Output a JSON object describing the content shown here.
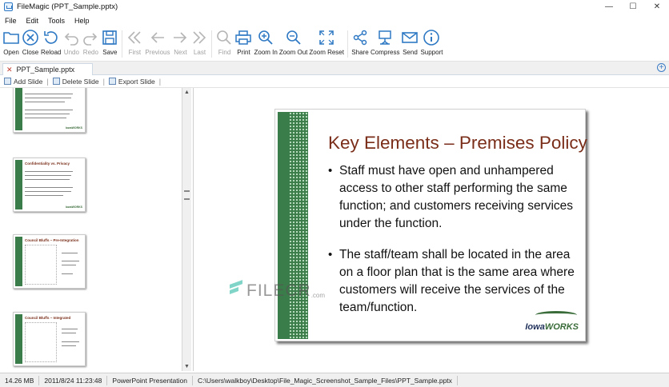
{
  "window": {
    "title": "FileMagic (PPT_Sample.pptx)",
    "controls": [
      "—",
      "☐",
      "✕"
    ]
  },
  "menu": [
    "File",
    "Edit",
    "Tools",
    "Help"
  ],
  "toolbar": {
    "open": "Open",
    "close": "Close",
    "reload": "Reload",
    "undo": "Undo",
    "redo": "Redo",
    "save": "Save",
    "first": "First",
    "previous": "Previous",
    "next": "Next",
    "last": "Last",
    "find": "Find",
    "print": "Print",
    "zoom_in": "Zoom In",
    "zoom_out": "Zoom Out",
    "zoom_reset": "Zoom Reset",
    "share": "Share",
    "compress": "Compress",
    "send": "Send",
    "support": "Support"
  },
  "tabs": {
    "doc_tab": "PPT_Sample.pptx",
    "close_glyph": "✕",
    "add_glyph": "+"
  },
  "slide_actions": {
    "add": "Add Slide",
    "delete": "Delete Slide",
    "export": "Export Slide",
    "sep": "|"
  },
  "thumbnails": [
    {
      "title": "",
      "logo": "IowaWORKS"
    },
    {
      "title": "Confidentiality vs. Privacy",
      "logo": "IowaWORKS"
    },
    {
      "title": "Council Bluffs – Pre-Integration",
      "logo": ""
    },
    {
      "title": "Council Bluffs – Integrated",
      "logo": ""
    }
  ],
  "slide": {
    "title": "Key Elements – Premises Policy",
    "bullets": [
      "Staff must have open and unhampered access to other staff performing the same function; and customers receiving services under the function.",
      "The staff/team shall be located in the area on a floor plan that is the same area where customers will receive the services of the team/function."
    ],
    "logo_main": "Iowa",
    "logo_accent": "WORKS"
  },
  "watermark": {
    "text": "FILECR",
    "suffix": ".com"
  },
  "status": {
    "size": "14.26 MB",
    "date": "2011/8/24 11:23:48",
    "type": "PowerPoint Presentation",
    "path": "C:\\Users\\walkboy\\Desktop\\File_Magic_Screenshot_Sample_Files\\PPT_Sample.pptx"
  },
  "colors": {
    "accent": "#2f79c4",
    "slide_bar": "#3b7d4a",
    "slide_title": "#7a2e19",
    "watermark": "#2fb8a5"
  }
}
